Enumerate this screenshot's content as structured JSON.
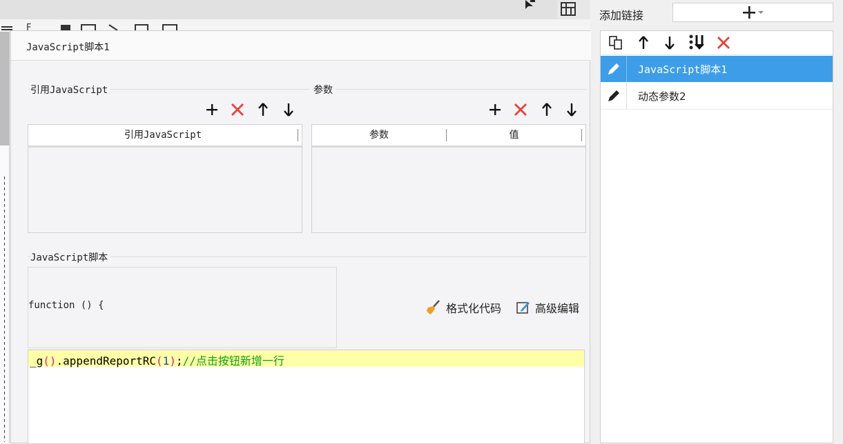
{
  "dialog": {
    "title": "JavaScript脚本1"
  },
  "ref_group": {
    "title": "引用JavaScript",
    "table_header": "引用JavaScript"
  },
  "param_group": {
    "title": "参数",
    "columns": [
      "参数",
      "值"
    ]
  },
  "script_group": {
    "title": "JavaScript脚本",
    "function_header": "function () {",
    "format_label": "格式化代码",
    "advanced_label": "高级编辑",
    "code": {
      "part1": "_g",
      "part2": "()",
      "part3": ".appendReportRC",
      "part4": "(",
      "part5": "1",
      "part6": ")",
      "part7": ";",
      "comment": "//点击按钮新增一行"
    }
  },
  "right_panel": {
    "add_link_label": "添加链接",
    "items": [
      {
        "label": "JavaScript脚本1",
        "selected": true
      },
      {
        "label": "动态参数2",
        "selected": false
      }
    ]
  },
  "colors": {
    "selection": "#3d9de8",
    "delete_red": "#e8413a",
    "highlight_line": "#ffffa8",
    "comment_green": "#10a010"
  },
  "icons": [
    "plus-icon",
    "delete-icon",
    "arrow-up-icon",
    "arrow-down-icon",
    "copy-icon",
    "move-bottom-icon",
    "pencil-icon",
    "broom-icon",
    "edit-icon"
  ]
}
